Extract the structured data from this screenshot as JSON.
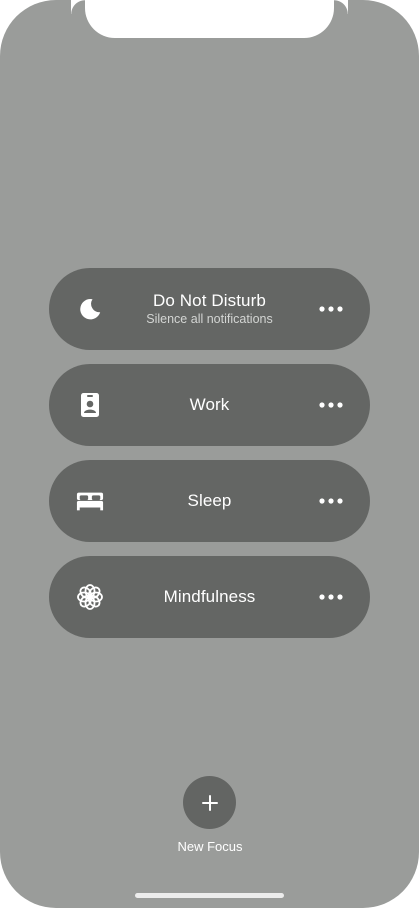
{
  "focus_modes": [
    {
      "icon": "moon-icon",
      "title": "Do Not Disturb",
      "subtitle": "Silence all notifications"
    },
    {
      "icon": "id-badge-icon",
      "title": "Work",
      "subtitle": ""
    },
    {
      "icon": "bed-icon",
      "title": "Sleep",
      "subtitle": ""
    },
    {
      "icon": "flower-icon",
      "title": "Mindfulness",
      "subtitle": ""
    }
  ],
  "new_focus": {
    "icon": "plus-icon",
    "label": "New Focus"
  },
  "colors": {
    "background": "#9a9c9a",
    "pill": "#646664",
    "text": "#ffffff"
  }
}
